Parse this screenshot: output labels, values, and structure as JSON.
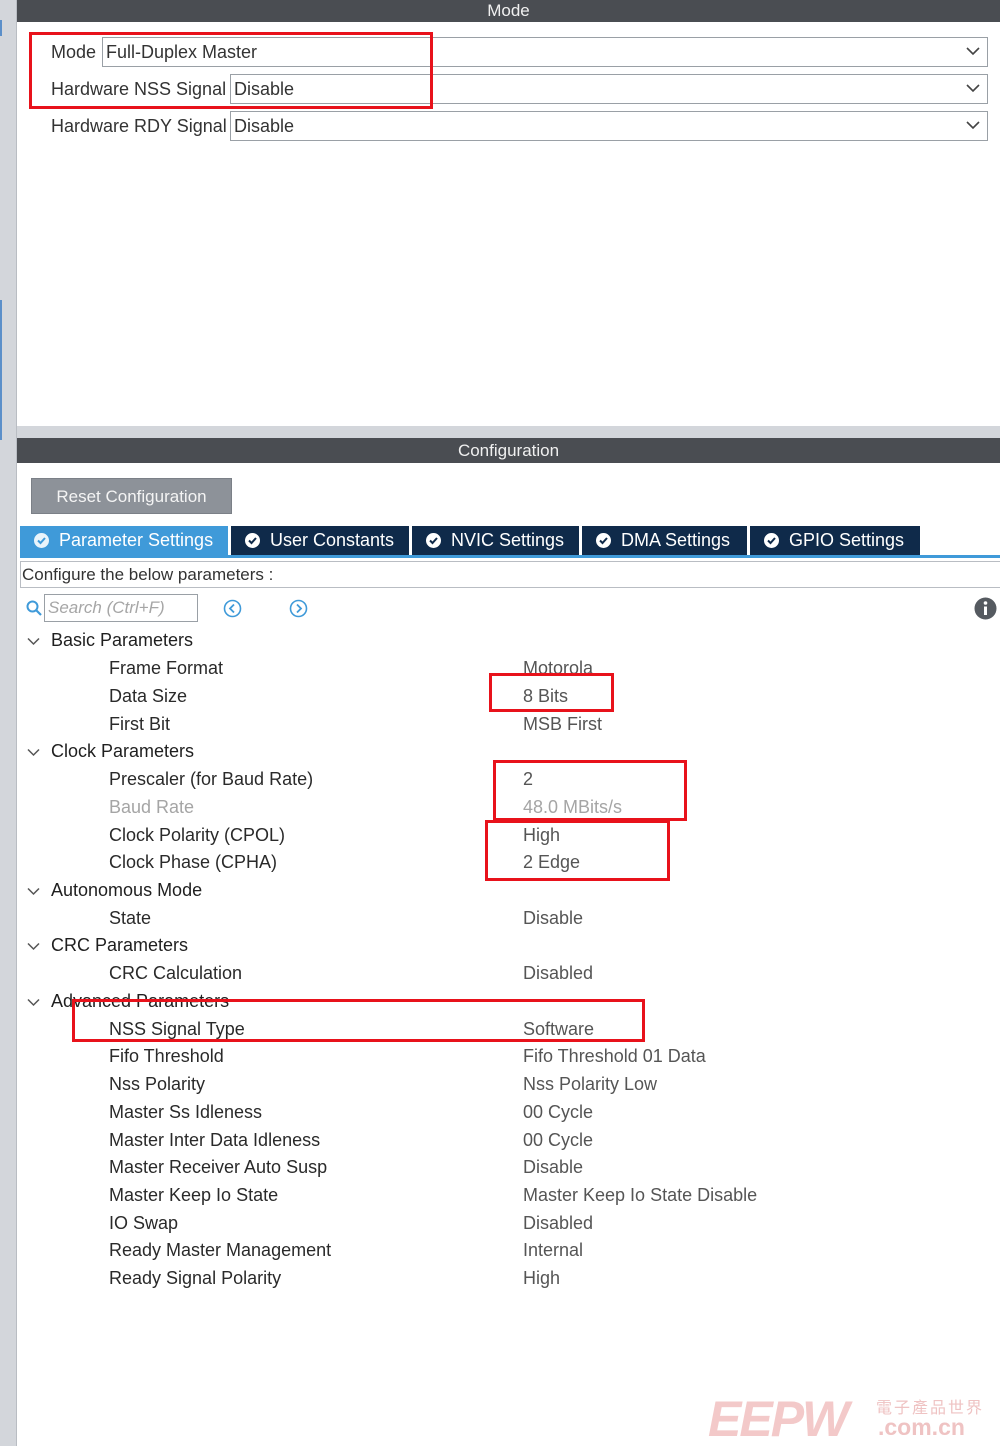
{
  "mode_panel": {
    "header": "Mode",
    "rows": [
      {
        "label": "Mode",
        "value": "Full-Duplex Master"
      },
      {
        "label": "Hardware NSS Signal",
        "value": "Disable"
      },
      {
        "label": "Hardware RDY Signal",
        "value": "Disable"
      }
    ]
  },
  "config_panel": {
    "header": "Configuration",
    "reset_label": "Reset Configuration",
    "tabs": [
      {
        "label": "Parameter Settings",
        "active": true
      },
      {
        "label": "User Constants",
        "active": false
      },
      {
        "label": "NVIC Settings",
        "active": false
      },
      {
        "label": "DMA Settings",
        "active": false
      },
      {
        "label": "GPIO Settings",
        "active": false
      }
    ],
    "configure_text": "Configure the below parameters :",
    "search_placeholder": "Search (Ctrl+F)"
  },
  "tree": {
    "groups": [
      {
        "label": "Basic Parameters",
        "params": [
          {
            "name": "Frame Format",
            "value": "Motorola"
          },
          {
            "name": "Data Size",
            "value": "8 Bits"
          },
          {
            "name": "First Bit",
            "value": "MSB First"
          }
        ]
      },
      {
        "label": "Clock Parameters",
        "params": [
          {
            "name": "Prescaler (for Baud Rate)",
            "value": "2"
          },
          {
            "name": "Baud Rate",
            "value": "48.0 MBits/s"
          },
          {
            "name": "Clock Polarity (CPOL)",
            "value": "High"
          },
          {
            "name": "Clock Phase (CPHA)",
            "value": "2 Edge"
          }
        ]
      },
      {
        "label": "Autonomous Mode",
        "params": [
          {
            "name": "State",
            "value": "Disable"
          }
        ]
      },
      {
        "label": "CRC Parameters",
        "params": [
          {
            "name": "CRC Calculation",
            "value": "Disabled"
          }
        ]
      },
      {
        "label": "Advanced Parameters",
        "params": [
          {
            "name": "NSS Signal Type",
            "value": "Software"
          },
          {
            "name": "Fifo Threshold",
            "value": "Fifo Threshold 01 Data"
          },
          {
            "name": "Nss Polarity",
            "value": "Nss Polarity Low"
          },
          {
            "name": "Master Ss Idleness",
            "value": "00 Cycle"
          },
          {
            "name": "Master Inter Data Idleness",
            "value": "00 Cycle"
          },
          {
            "name": "Master Receiver Auto Susp",
            "value": "Disable"
          },
          {
            "name": "Master Keep Io State",
            "value": "Master Keep Io State Disable"
          },
          {
            "name": "IO Swap",
            "value": "Disabled"
          },
          {
            "name": "Ready Master Management",
            "value": "Internal"
          },
          {
            "name": "Ready Signal Polarity",
            "value": "High"
          }
        ]
      }
    ]
  },
  "watermark": {
    "logo": "EEPW",
    "cn": "電子產品世界",
    "domain": ".com.cn"
  },
  "colors": {
    "header_bg": "#4a4d52",
    "tab_active": "#3f9ad9",
    "tab_inactive": "#0f2a4a",
    "highlight": "#e8121b"
  }
}
